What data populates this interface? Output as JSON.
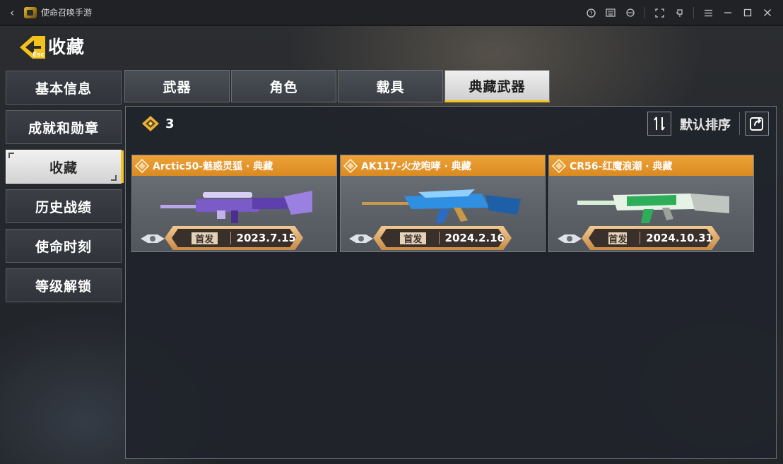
{
  "window": {
    "title": "使命召唤手游"
  },
  "header": {
    "esc_label": "Esc",
    "title": "收藏"
  },
  "sidebar": {
    "items": [
      {
        "label": "基本信息",
        "active": false
      },
      {
        "label": "成就和勋章",
        "active": false
      },
      {
        "label": "收藏",
        "active": true
      },
      {
        "label": "历史战绩",
        "active": false
      },
      {
        "label": "使命时刻",
        "active": false
      },
      {
        "label": "等级解锁",
        "active": false
      }
    ]
  },
  "tabs": [
    {
      "label": "武器",
      "active": false
    },
    {
      "label": "角色",
      "active": false
    },
    {
      "label": "载具",
      "active": false
    },
    {
      "label": "典藏武器",
      "active": true
    }
  ],
  "toolbar": {
    "count": "3",
    "sort_label": "默认排序"
  },
  "cards": [
    {
      "title": "Arctic50-魅惑灵狐 · 典藏",
      "tag": "首发",
      "date": "2023.7.15",
      "color": "#8a6bd6"
    },
    {
      "title": "AK117-火龙咆哮 · 典藏",
      "tag": "首发",
      "date": "2024.2.16",
      "color": "#2f8fe0"
    },
    {
      "title": "CR56-红魔浪潮 · 典藏",
      "tag": "首发",
      "date": "2024.10.31",
      "color": "#2fae5a"
    }
  ],
  "colors": {
    "accent": "#f4c21c",
    "card_header": "#e69a2e"
  }
}
